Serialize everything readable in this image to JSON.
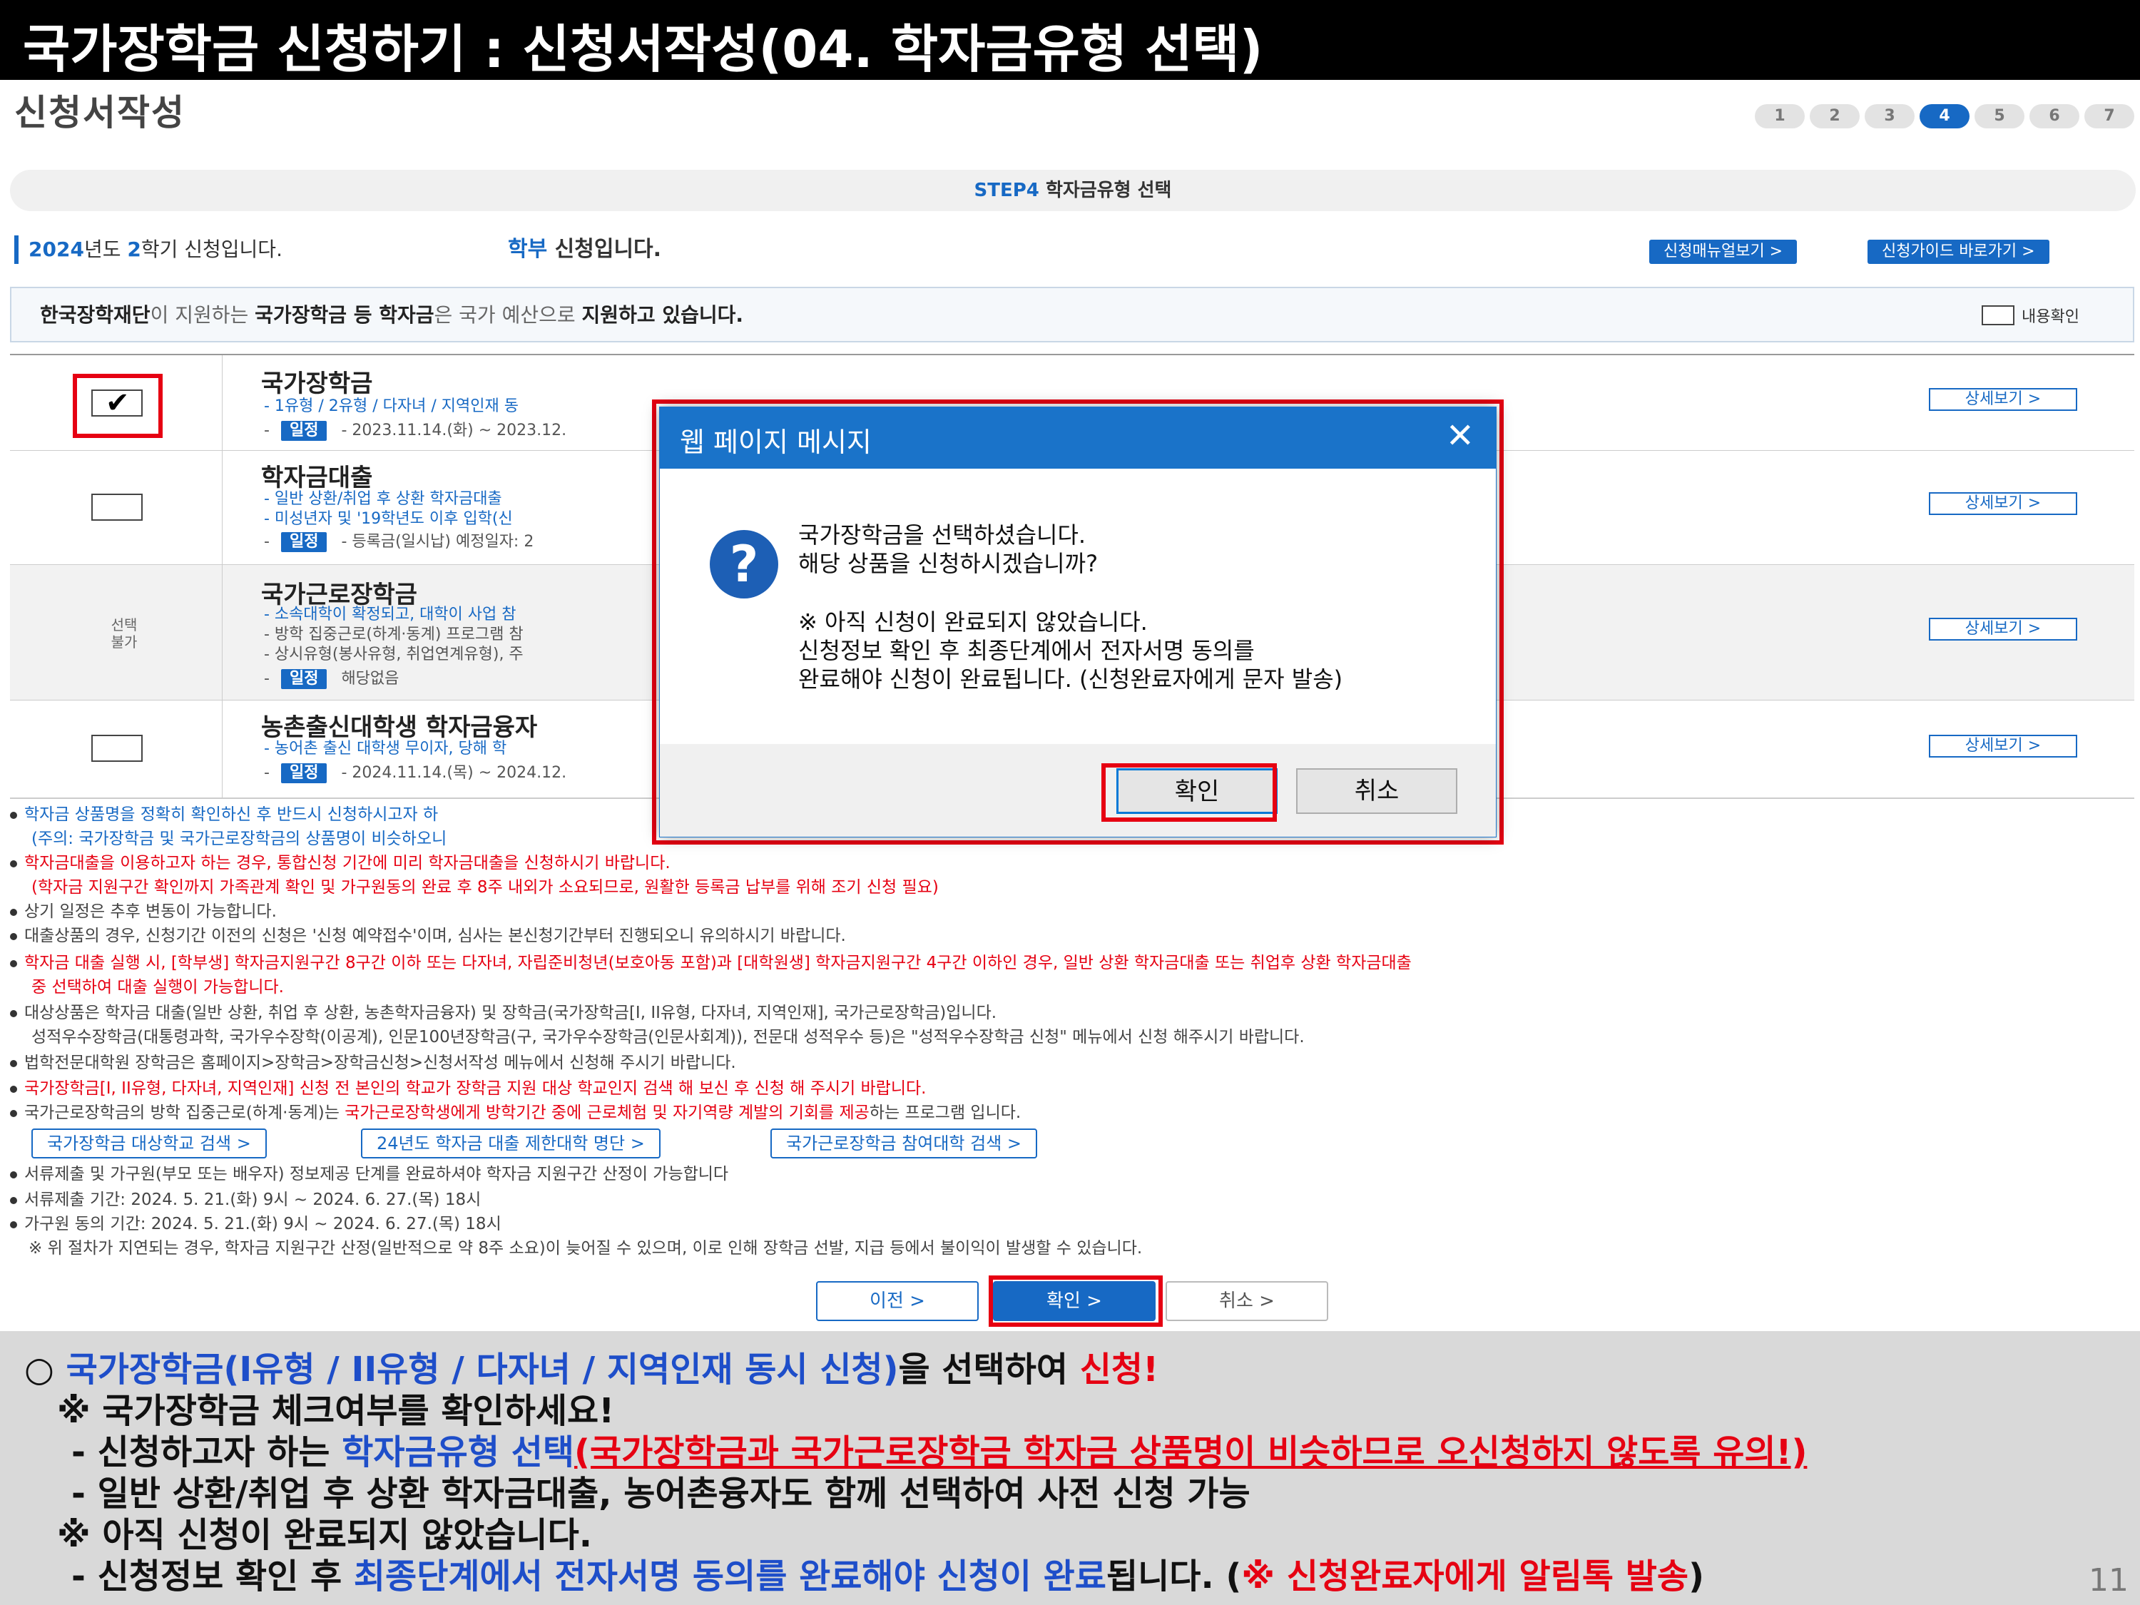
{
  "header": {
    "title": "국가장학금 신청하기 : 신청서작성(04. 학자금유형 선택)"
  },
  "page": {
    "section_title": "신청서작성"
  },
  "steps": {
    "items": [
      "1",
      "2",
      "3",
      "4",
      "5",
      "6",
      "7"
    ],
    "active": "4"
  },
  "step_band": {
    "label_step": "STEP4",
    "label_text": "학자금유형 선택"
  },
  "info": {
    "year": "2024",
    "year_suffix": "년도 ",
    "semester": "2",
    "semester_suffix": "학기 신청입니다.",
    "level": "학부",
    "level_suffix": " 신청입니다.",
    "manual_btn": "신청매뉴얼보기 >",
    "guide_btn": "신청가이드 바로가기 >"
  },
  "notice": {
    "p1": "한국장학재단",
    "p2": "이 지원하는 ",
    "p3": "국가장학금 등 학자금",
    "p4": "은 국가 예산으로 ",
    "p5": "지원하고 있습니다.",
    "confirm_label": "내용확인"
  },
  "products": {
    "p1": {
      "name": "국가장학금",
      "desc1": "- 1유형 / 2유형 / 다자녀 / 지역인재 동",
      "schedule_tag": "일정",
      "schedule": "- 2023.11.14.(화) ~ 2023.12.",
      "detail": "상세보기 >"
    },
    "p2": {
      "name": "학자금대출",
      "desc1": "- 일반 상환/취업 후 상환 학자금대출",
      "desc2": "- 미성년자 및 '19학년도 이후 입학(신",
      "schedule_tag": "일정",
      "schedule": "- 등록금(일시납) 예정일자: 2",
      "detail": "상세보기 >"
    },
    "p3": {
      "name": "국가근로장학금",
      "na_label": "선택\n불가",
      "desc1": "- 소속대학이 확정되고, 대학이 사업 참",
      "desc2": "- 방학 집중근로(하계·동계) 프로그램 참",
      "desc3": "- 상시유형(봉사유형, 취업연계유형), 주",
      "schedule_tag": "일정",
      "schedule": "해당없음",
      "detail": "상세보기 >"
    },
    "p4": {
      "name": "농촌출신대학생 학자금융자",
      "desc1": "- 농어촌 출신 대학생 무이자, 당해 학",
      "schedule_tag": "일정",
      "schedule": "- 2024.11.14.(목) ~ 2024.12.",
      "detail": "상세보기 >"
    }
  },
  "notes": {
    "n1": "학자금 상품명을 정확히 확인하신 후 반드시 신청하시고자 하",
    "n1b": "(주의: 국가장학금 및 국가근로장학금의 상품명이 비슷하오니",
    "n2": "학자금대출을 이용하고자 하는 경우, 통합신청 기간에 미리 학자금대출을 신청하시기 바랍니다.",
    "n2b": "(학자금 지원구간 확인까지 가족관계 확인 및 가구원동의 완료 후 8주 내외가 소요되므로, 원활한 등록금 납부를 위해 조기 신청 필요)",
    "n3": "상기 일정은 추후 변동이 가능합니다.",
    "n4": "대출상품의 경우, 신청기간 이전의 신청은 '신청 예약접수'이며, 심사는 본신청기간부터 진행되오니 유의하시기 바랍니다.",
    "n5": "학자금 대출 실행 시, [학부생] 학자금지원구간 8구간 이하 또는 다자녀, 자립준비청년(보호아동 포함)과 [대학원생] 학자금지원구간 4구간 이하인 경우, 일반 상환 학자금대출 또는 취업후 상환 학자금대출",
    "n5b": "중 선택하여 대출 실행이 가능합니다.",
    "n6": "대상상품은 학자금 대출(일반 상환, 취업 후 상환, 농촌학자금융자) 및 장학금(국가장학금[I, II유형, 다자녀, 지역인재], 국가근로장학금)입니다.",
    "n6b": "성적우수장학금(대통령과학, 국가우수장학(이공계), 인문100년장학금(구, 국가우수장학금(인문사회계)), 전문대 성적우수 등)은 \"성적우수장학금 신청\" 메뉴에서 신청 해주시기 바랍니다.",
    "n7": "법학전문대학원 장학금은 홈페이지>장학금>장학금신청>신청서작성 메뉴에서 신청해 주시기 바랍니다.",
    "n8": "국가장학금[I, II유형, 다자녀, 지역인재] 신청 전 본인의 학교가 장학금 지원 대상 학교인지 검색 해 보신 후 신청 해 주시기 바랍니다.",
    "n9a": "국가근로장학금의 방학 집중근로(하계·동계)는 ",
    "n9b": "국가근로장학생에게 방학기간 중에 근로체험 및 자기역량 계발의 기회를 제공",
    "n9c": "하는 프로그램 입니다.",
    "n10": "서류제출 및 가구원(부모 또는 배우자) 정보제공 단계를 완료하셔야 학자금 지원구간 산정이 가능합니다",
    "n11": "서류제출 기간: 2024. 5. 21.(화) 9시 ~ 2024. 6. 27.(목) 18시",
    "n12": "가구원 동의 기간: 2024. 5. 21.(화) 9시 ~ 2024. 6. 27.(목) 18시",
    "n13": "※ 위 절차가 지연되는 경우, 학자금 지원구간 산정(일반적으로 약 8주 소요)이 늦어질 수 있으며, 이로 인해 장학금 선발, 지급 등에서 불이익이 발생할 수 있습니다."
  },
  "links": {
    "l1": "국가장학금 대상학교 검색 >",
    "l2": "24년도 학자금 대출 제한대학 명단 >",
    "l3": "국가근로장학금 참여대학 검색 >"
  },
  "bottom_buttons": {
    "prev": "이전   >",
    "ok": "확인   >",
    "cancel": "취소   >"
  },
  "dialog": {
    "title": "웹 페이지 메시지",
    "close": "✕",
    "icon": "?",
    "line1": "국가장학금을 선택하셨습니다.",
    "line2": "해당 상품을 신청하시겠습니까?",
    "line3": "※ 아직 신청이 완료되지 않았습니다.",
    "line4": "신청정보 확인 후 최종단계에서 전자서명 동의를",
    "line5": "완료해야 신청이 완료됩니다. (신청완료자에게 문자 발송)",
    "ok": "확인",
    "cancel": "취소"
  },
  "summary": {
    "l1a": "○ ",
    "l1b": "국가장학금(I유형 / II유형 / 다자녀 / 지역인재 동시 신청)",
    "l1c": "을 선택하여 ",
    "l1d": "신청!",
    "l2": "※ 국가장학금 체크여부를 확인하세요!",
    "l3a": "- 신청하고자 하는 ",
    "l3b": "학자금유형 선택",
    "l3c": "(국가장학금과 국가근로장학금 학자금 상품명이 비슷하므로 오신청하지 않도록 유의!)",
    "l4": "- 일반 상환/취업 후 상환 학자금대출, 농어촌융자도 함께 선택하여 사전 신청 가능",
    "l5": "※ 아직 신청이 완료되지 않았습니다.",
    "l6a": "- 신청정보 확인 후 ",
    "l6b": "최종단계에서 전자서명 동의를 완료해야 신청이 완료",
    "l6c": "됩니다. (",
    "l6d": "※ 신청완료자에게 알림톡 발송",
    "l6e": ")"
  },
  "page_number": "11",
  "colors": {
    "accent": "#1769c4",
    "alert": "#e60012",
    "header_bg": "#000000",
    "summary_bg": "#d9d9d9"
  }
}
